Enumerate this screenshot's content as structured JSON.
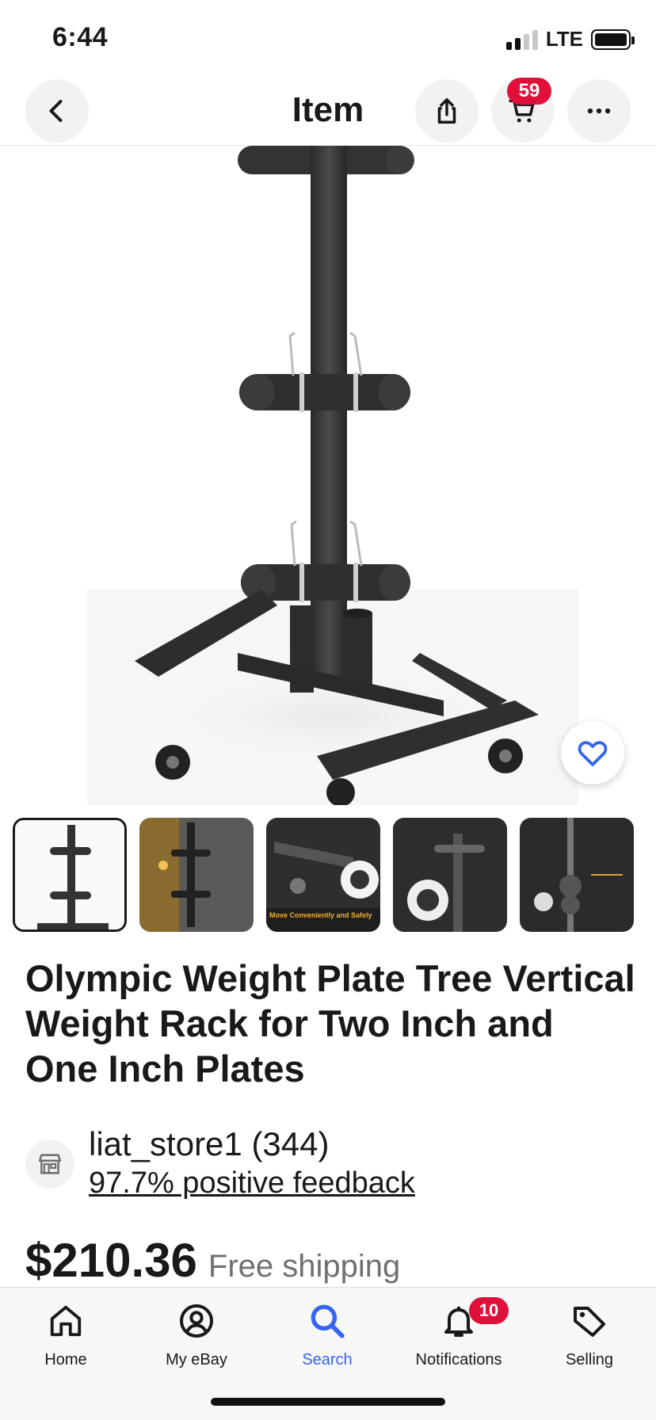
{
  "status_bar": {
    "time": "6:44",
    "network": "LTE",
    "icons": [
      "signal-icon",
      "battery-icon"
    ]
  },
  "nav": {
    "title": "Item",
    "cart_count": "59",
    "icons": [
      "back-chevron-icon",
      "share-icon",
      "cart-icon",
      "more-icon"
    ]
  },
  "gallery": {
    "image_count": 5,
    "selected_index": 0,
    "thumbnails": [
      {
        "caption": ""
      },
      {
        "caption": ""
      },
      {
        "caption": "Move Conveniently and Safely"
      },
      {
        "caption": ""
      },
      {
        "caption": ""
      }
    ]
  },
  "item": {
    "title": "Olympic Weight Plate Tree Vertical Weight Rack for Two Inch and One Inch Plates",
    "price": "$210.36",
    "shipping": "Free shipping"
  },
  "seller": {
    "name": "liat_store1 (344)",
    "feedback": "97.7% positive feedback"
  },
  "tabs": [
    {
      "label": "Home",
      "icon": "home-icon"
    },
    {
      "label": "My eBay",
      "icon": "profile-icon"
    },
    {
      "label": "Search",
      "icon": "search-icon",
      "active": true
    },
    {
      "label": "Notifications",
      "icon": "bell-icon",
      "badge": "10"
    },
    {
      "label": "Selling",
      "icon": "tag-icon"
    }
  ],
  "colors": {
    "accent": "#3665f3",
    "badge": "#e0103a",
    "text": "#191919",
    "muted": "#707070"
  }
}
